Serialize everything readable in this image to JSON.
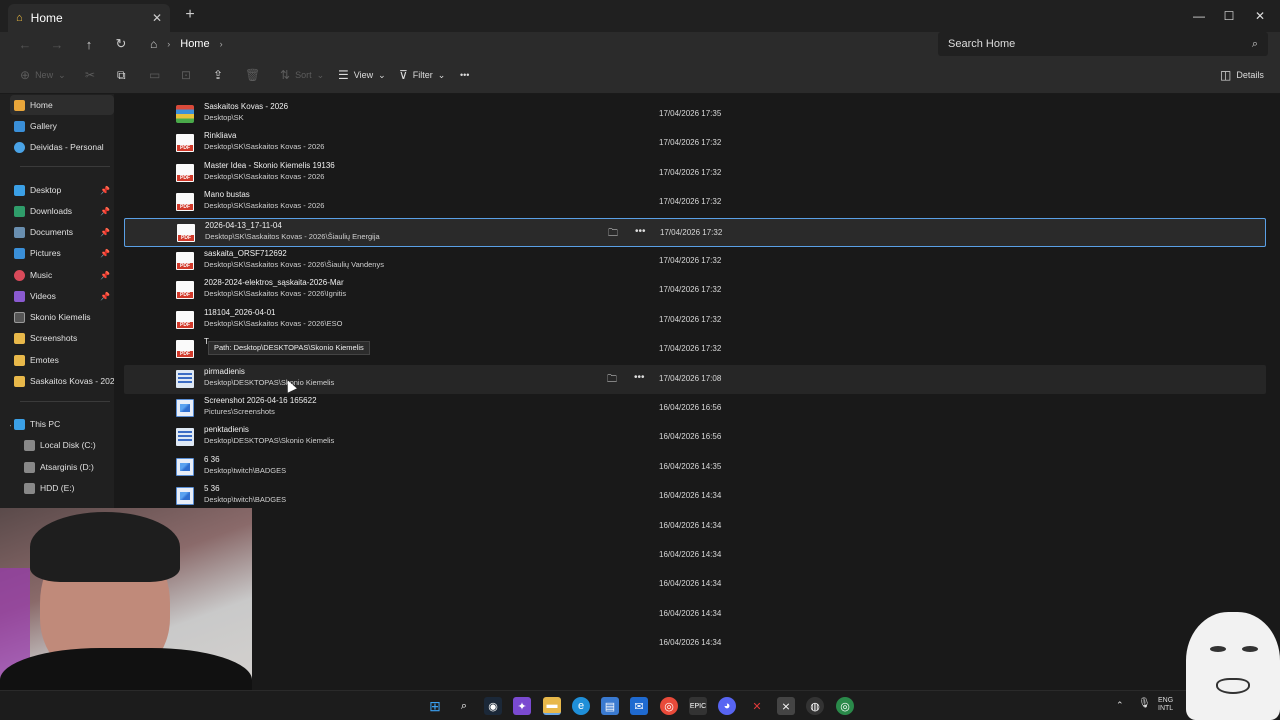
{
  "window": {
    "tab_title": "Home",
    "minimize": "—",
    "maximize": "☐",
    "close": "✕",
    "new_tab": "+"
  },
  "nav": {
    "breadcrumb": "Home",
    "search_placeholder": "Search Home"
  },
  "toolbar": {
    "new_label": "New",
    "sort_label": "Sort",
    "view_label": "View",
    "filter_label": "Filter",
    "more_label": "•••",
    "details_label": "Details"
  },
  "sidebar": {
    "items": [
      {
        "label": "Home",
        "icon": "home-icon"
      },
      {
        "label": "Gallery",
        "icon": "gallery-icon"
      },
      {
        "label": "Deividas - Personal",
        "icon": "cloud-icon"
      },
      {
        "label": "Desktop",
        "icon": "desktop-icon"
      },
      {
        "label": "Downloads",
        "icon": "download-icon"
      },
      {
        "label": "Documents",
        "icon": "documents-icon"
      },
      {
        "label": "Pictures",
        "icon": "pictures-icon"
      },
      {
        "label": "Music",
        "icon": "music-icon"
      },
      {
        "label": "Videos",
        "icon": "videos-icon"
      },
      {
        "label": "Skonio Kiemelis",
        "icon": "folder-icon"
      },
      {
        "label": "Screenshots",
        "icon": "folder-icon"
      },
      {
        "label": "Emotes",
        "icon": "folder-icon"
      },
      {
        "label": "Saskaitos Kovas - 2026",
        "icon": "folder-icon"
      },
      {
        "label": "This PC",
        "icon": "pc-icon"
      },
      {
        "label": "Local Disk (C:)",
        "icon": "drive-icon"
      },
      {
        "label": "Atsarginis (D:)",
        "icon": "drive-icon"
      },
      {
        "label": "HDD (E:)",
        "icon": "drive-icon"
      }
    ]
  },
  "files": [
    {
      "name": "Saskaitos Kovas - 2026",
      "path": "Desktop\\SK",
      "date": "17/04/2026 17:35",
      "type": "rar"
    },
    {
      "name": "Rinkliava",
      "path": "Desktop\\SK\\Saskaitos Kovas - 2026",
      "date": "17/04/2026 17:32",
      "type": "pdf"
    },
    {
      "name": "Master Idea - Skonio Kiemelis 19136",
      "path": "Desktop\\SK\\Saskaitos Kovas - 2026",
      "date": "17/04/2026 17:32",
      "type": "pdf"
    },
    {
      "name": "Mano bustas",
      "path": "Desktop\\SK\\Saskaitos Kovas - 2026",
      "date": "17/04/2026 17:32",
      "type": "pdf"
    },
    {
      "name": "2026-04-13_17-11-04",
      "path": "Desktop\\SK\\Saskaitos Kovas - 2026\\Šiaulių Energija",
      "date": "17/04/2026 17:32",
      "type": "pdf"
    },
    {
      "name": "saskaita_ORSF712692",
      "path": "Desktop\\SK\\Saskaitos Kovas - 2026\\Šiaulių Vandenys",
      "date": "17/04/2026 17:32",
      "type": "pdf"
    },
    {
      "name": "2028-2024-elektros_sąskaita-2026-Mar",
      "path": "Desktop\\SK\\Saskaitos Kovas - 2026\\Ignitis",
      "date": "17/04/2026 17:32",
      "type": "pdf"
    },
    {
      "name": "118104_2026-04-01",
      "path": "Desktop\\SK\\Saskaitos Kovas - 2026\\ESO",
      "date": "17/04/2026 17:32",
      "type": "pdf"
    },
    {
      "name": "T",
      "path": "",
      "date": "17/04/2026 17:32",
      "type": "pdf"
    },
    {
      "name": "pirmadienis",
      "path": "Desktop\\DESKTOPAS\\Skonio Kiemelis",
      "date": "17/04/2026 17:08",
      "type": "doc"
    },
    {
      "name": "Screenshot 2026-04-16 165622",
      "path": "Pictures\\Screenshots",
      "date": "16/04/2026 16:56",
      "type": "img"
    },
    {
      "name": "penktadienis",
      "path": "Desktop\\DESKTOPAS\\Skonio Kiemelis",
      "date": "16/04/2026 16:56",
      "type": "doc"
    },
    {
      "name": "6 36",
      "path": "Desktop\\twitch\\BADGES",
      "date": "16/04/2026 14:35",
      "type": "img"
    },
    {
      "name": "5 36",
      "path": "Desktop\\twitch\\BADGES",
      "date": "16/04/2026 14:34",
      "type": "img"
    },
    {
      "name": "",
      "path": "ch\\BADGES",
      "date": "16/04/2026 14:34",
      "type": "none"
    },
    {
      "name": "",
      "path": "ch\\BADGES",
      "date": "16/04/2026 14:34",
      "type": "none"
    },
    {
      "name": "",
      "path": "ch\\BADGES",
      "date": "16/04/2026 14:34",
      "type": "none"
    },
    {
      "name": "",
      "path": "ch\\BADGES",
      "date": "16/04/2026 14:34",
      "type": "none"
    },
    {
      "name": "",
      "path": "ch\\BADGES",
      "date": "16/04/2026 14:34",
      "type": "none"
    }
  ],
  "tooltip": "Path: Desktop\\DESKTOPAS\\Skonio Kiemelis",
  "tray": {
    "lang_1": "ENG",
    "lang_2": "INTL"
  }
}
